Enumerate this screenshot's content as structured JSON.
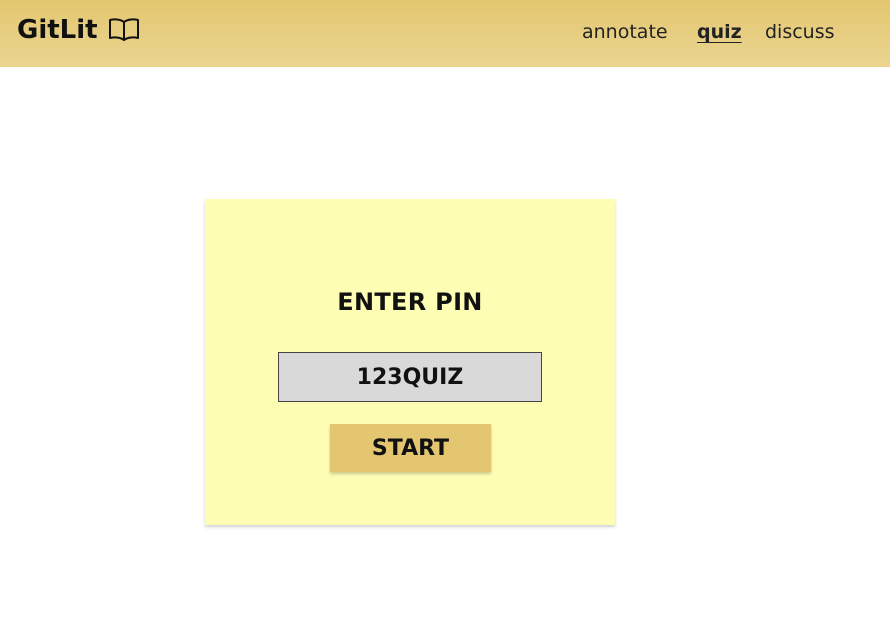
{
  "header": {
    "brand_name": "GitLit",
    "brand_icon": "open-book-icon",
    "nav": [
      {
        "label": "annotate",
        "active": false
      },
      {
        "label": "quiz",
        "active": true
      },
      {
        "label": "discuss",
        "active": false
      }
    ],
    "background_color": "#e3c66f"
  },
  "quiz_card": {
    "title": "ENTER PIN",
    "pin_value": "123QUIZ",
    "start_label": "START",
    "card_color": "#fdfdb4",
    "button_color": "#e3c66f",
    "input_color": "#d9d9d9"
  }
}
